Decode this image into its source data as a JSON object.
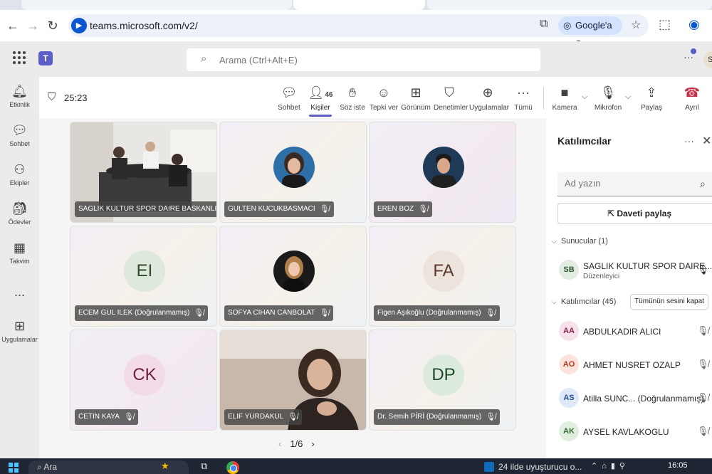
{
  "browser": {
    "url": "teams.microsoft.com/v2/",
    "google_button": "Google'a Sor"
  },
  "teams_header": {
    "search_placeholder": "Arama (Ctrl+Alt+E)",
    "profile_initial": "S"
  },
  "rail": [
    {
      "label": "Etkinlik",
      "icon": "bell-icon"
    },
    {
      "label": "Sohbet",
      "icon": "chat-icon"
    },
    {
      "label": "Ekipler",
      "icon": "teams-icon"
    },
    {
      "label": "Ödevler",
      "icon": "assignments-icon"
    },
    {
      "label": "Takvim",
      "icon": "calendar-icon"
    },
    {
      "label": "...",
      "icon": "more-icon"
    },
    {
      "label": "Uygulamalar",
      "icon": "apps-icon"
    }
  ],
  "meeting": {
    "timer": "25:23",
    "people_count": "46",
    "toolbar": {
      "chat": "Sohbet",
      "people": "Kişiler",
      "raise_hand": "Söz iste",
      "react": "Tepki ver",
      "view": "Görünüm",
      "moderation": "Denetimler",
      "apps": "Uygulamalar",
      "more": "Tümü",
      "camera": "Kamera",
      "mic": "Mikrofon",
      "share": "Paylaş",
      "leave": "Ayrıl"
    },
    "pager": "1/6"
  },
  "tiles": [
    {
      "name": "SAGLIK KULTUR SPOR DAIRE BASKANLIGI",
      "type": "video",
      "muted": false
    },
    {
      "name": "GULTEN KUCUKBASMACI",
      "type": "photo",
      "muted": true
    },
    {
      "name": "EREN BOZ",
      "type": "photo",
      "muted": true
    },
    {
      "name": "ECEM GUL ILEK (Doğrulanmamış)",
      "type": "initials",
      "initials": "EI",
      "muted": true
    },
    {
      "name": "SOFYA CIHAN CANBOLAT",
      "type": "photo",
      "muted": true
    },
    {
      "name": "Figen Aşıkoğlu (Doğrulanmamış)",
      "type": "initials",
      "initials": "FA",
      "muted": true
    },
    {
      "name": "CETIN KAYA",
      "type": "initials",
      "initials": "CK",
      "muted": true
    },
    {
      "name": "ELIF YURDAKUL",
      "type": "video",
      "muted": true
    },
    {
      "name": "Dr. Semih PİRİ (Doğrulanmamış)",
      "type": "initials",
      "initials": "DP",
      "muted": true
    }
  ],
  "panel": {
    "title": "Katılımcılar",
    "search_placeholder": "Ad yazın",
    "share_invite": "Daveti paylaş",
    "presenters_header": "Sunucular (1)",
    "attendees_header": "Katılımcılar (45)",
    "mute_all": "Tümünün sesini kapat",
    "presenters": [
      {
        "initials": "SB",
        "name": "SAGLIK KULTUR SPOR DAIRE...",
        "role": "Düzenleyici"
      }
    ],
    "attendees": [
      {
        "initials": "AA",
        "name": "ABDULKADIR ALICI",
        "avatar_bg": "#f6e1ea",
        "avatar_fg": "#8b2252"
      },
      {
        "initials": "AO",
        "name": "AHMET NUSRET OZALP",
        "avatar_bg": "#fde3dc",
        "avatar_fg": "#b3391c"
      },
      {
        "initials": "AS",
        "name": "Atilla SUNC... (Doğrulanmamış)",
        "avatar_bg": "#dfe8f6",
        "avatar_fg": "#1f4e8c"
      },
      {
        "initials": "AK",
        "name": "AYSEL KAVLAKOGLU",
        "avatar_bg": "#e0eee0",
        "avatar_fg": "#2f6b2f"
      }
    ]
  },
  "taskbar": {
    "search": "Ara",
    "news": "24 ilde uyuşturucu o...",
    "time": "16:05"
  },
  "colors": {
    "accent": "#5b5fc7",
    "leave": "#c4314b"
  }
}
